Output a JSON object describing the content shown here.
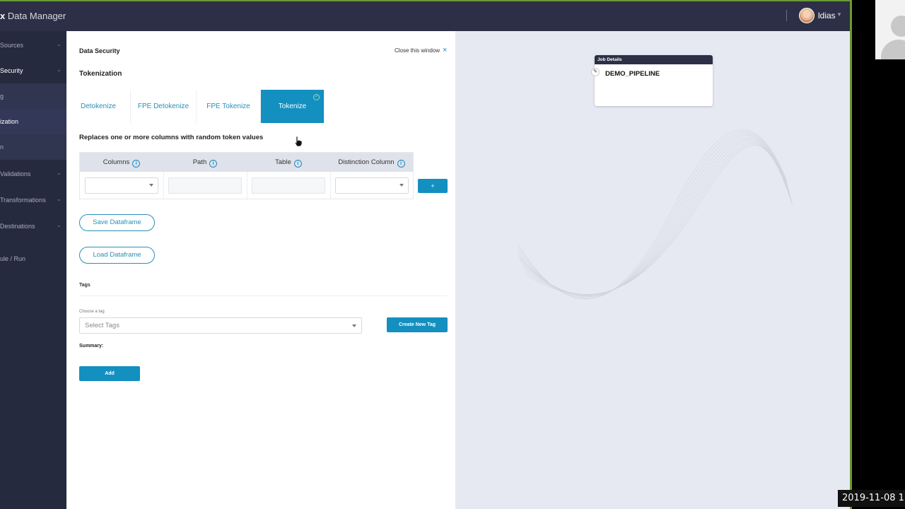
{
  "app": {
    "brand_prefix": "x",
    "brand_name": "Data Manager",
    "user": "ldias"
  },
  "sidebar": {
    "items": [
      {
        "label": "Sources"
      },
      {
        "label": "Security"
      },
      {
        "label": "g"
      },
      {
        "label": "ization"
      },
      {
        "label": "n"
      },
      {
        "label": "Validations"
      },
      {
        "label": "Transformations"
      },
      {
        "label": "Destinations"
      },
      {
        "label": "ule / Run"
      }
    ]
  },
  "panel": {
    "breadcrumb": "Data Security",
    "close_label": "Close this window",
    "close_icon": "×",
    "section_title": "Tokenization",
    "tabs": [
      {
        "label": "Detokenize"
      },
      {
        "label": "FPE Detokenize"
      },
      {
        "label": "FPE Tokenize"
      },
      {
        "label": "Tokenize"
      }
    ],
    "description": "Replaces one or more columns with random token values",
    "table": {
      "headers": [
        "Columns",
        "Path",
        "Table",
        "Distinction Column"
      ],
      "info_icon": "i"
    },
    "plus_label": "+",
    "save_dataframe": "Save Dataframe",
    "load_dataframe": "Load Dataframe",
    "tags_label": "Tags",
    "choose_tag_label": "Choose a tag",
    "tags_placeholder": "Select Tags",
    "create_tag": "Create New Tag",
    "summary_label": "Summary:",
    "add_label": "Add"
  },
  "canvas": {
    "job_header": "Job Details",
    "job_name": "DEMO_PIPELINE",
    "edit_icon": "✎"
  },
  "overlay": {
    "timestamp": "2019-11-08 1"
  },
  "colors": {
    "accent": "#138fc0",
    "sidebar": "#262a3e",
    "topbar": "#2c2f45",
    "frame": "#6a9a34"
  }
}
